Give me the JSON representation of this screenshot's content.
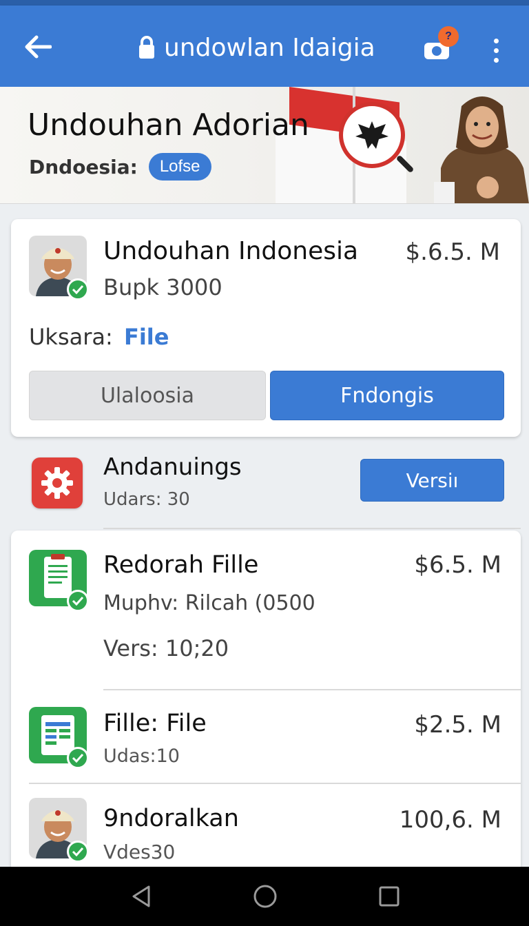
{
  "header": {
    "title": "undowlan Idaigia",
    "notification_count": "?"
  },
  "hero": {
    "title": "Undouhan Adorian",
    "subtitle": "Dndoesia:",
    "pill": "Lofse"
  },
  "featured": {
    "name": "Undouhan Indonesia",
    "subtitle": "Bupk 3000",
    "price": "$.6.5. M",
    "label": "Uksara:",
    "label_value": "File",
    "secondary_button": "Ulaloosia",
    "primary_button": "Fndongis"
  },
  "settings_row": {
    "name": "Andanuings",
    "subtitle": "Udars: 30",
    "button": "Versiı"
  },
  "list": [
    {
      "name": "Redorah Fille",
      "line1": "Muphv: Rilcah (0500",
      "line2": "Vers: 10;20",
      "price": "$6.5. M"
    },
    {
      "name": "Fille: File",
      "line1": "Udas:10",
      "price": "$2.5. M"
    },
    {
      "name": "9ndoralkan",
      "line1": "Vdes30",
      "price": "100,6. M"
    }
  ],
  "colors": {
    "primary": "#3b7bd4",
    "check": "#2fa84f",
    "badge": "#f06a2e",
    "settings_icon": "#e0403a"
  }
}
